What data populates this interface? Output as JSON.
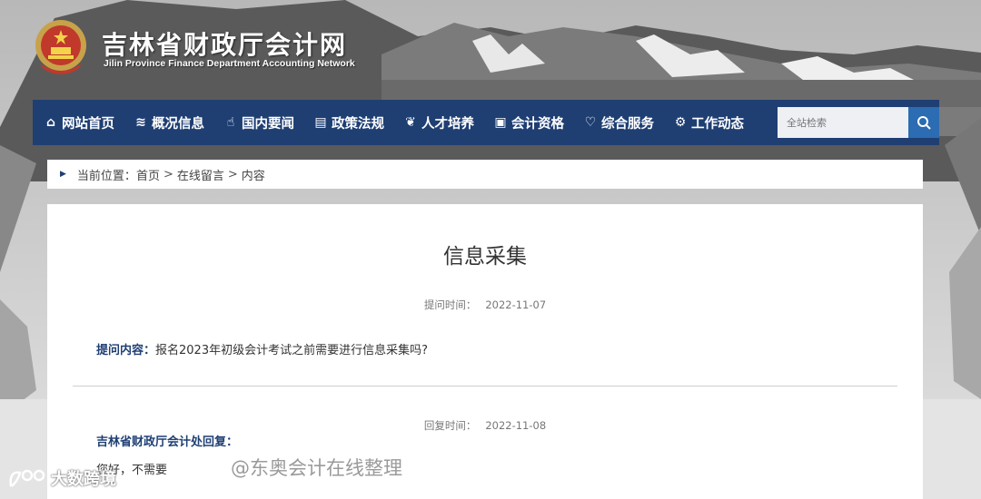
{
  "header": {
    "title": "吉林省财政厅会计网",
    "subtitle": "Jilin Province Finance Department Accounting Network"
  },
  "nav": {
    "items": [
      {
        "label": "网站首页",
        "icon": "home-icon",
        "glyph": "⌂"
      },
      {
        "label": "概况信息",
        "icon": "layers-icon",
        "glyph": "≋"
      },
      {
        "label": "国内要闻",
        "icon": "hand-icon",
        "glyph": "☝"
      },
      {
        "label": "政策法规",
        "icon": "document-icon",
        "glyph": "▤"
      },
      {
        "label": "人才培养",
        "icon": "leaf-icon",
        "glyph": "❦"
      },
      {
        "label": "会计资格",
        "icon": "certificate-icon",
        "glyph": "▣"
      },
      {
        "label": "综合服务",
        "icon": "heart-icon",
        "glyph": "♡"
      },
      {
        "label": "工作动态",
        "icon": "gear-icon",
        "glyph": "⚙"
      }
    ],
    "search_placeholder": "全站检索"
  },
  "breadcrumb": {
    "prefix": "当前位置：",
    "items": [
      "首页",
      "在线留言",
      "内容"
    ],
    "separator": ">"
  },
  "content": {
    "title": "信息采集",
    "question_time_label": "提问时间：",
    "question_time": "2022-11-07",
    "question_label": "提问内容：",
    "question_text": "报名2023年初级会计考试之前需要进行信息采集吗?",
    "reply_time_label": "回复时间：",
    "reply_time": "2022-11-08",
    "reply_label": "吉林省财政厅会计处回复：",
    "reply_text": "您好，不需要"
  },
  "watermarks": {
    "center": "@东奥会计在线整理",
    "left": "大数跨境"
  },
  "colors": {
    "nav_bg": "#1f3f73",
    "accent_label": "#1f3f73",
    "search_button": "#2b6cb3"
  }
}
